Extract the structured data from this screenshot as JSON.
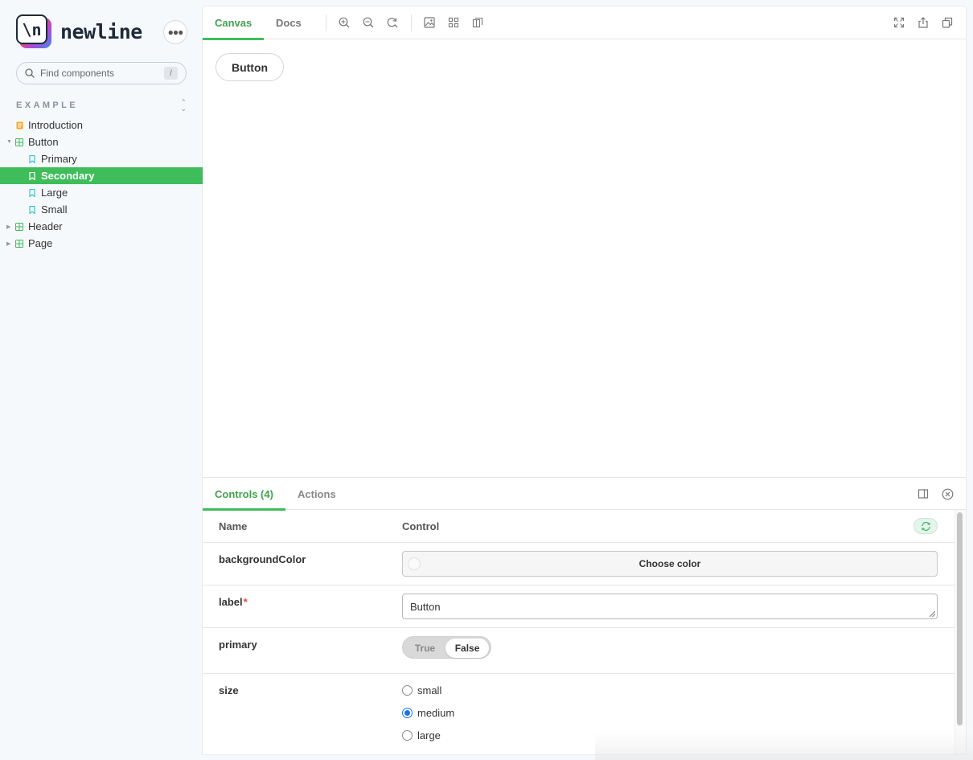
{
  "brand": {
    "logo_glyph": "\\n",
    "name": "newline"
  },
  "sidebar": {
    "search_placeholder": "Find components",
    "search_shortcut": "/",
    "section_title": "EXAMPLE",
    "items": [
      {
        "label": "Introduction",
        "icon": "document-icon",
        "kind": "doc"
      },
      {
        "label": "Button",
        "icon": "component-icon",
        "kind": "component",
        "expanded": true
      },
      {
        "label": "Primary",
        "icon": "bookmark-icon",
        "kind": "story"
      },
      {
        "label": "Secondary",
        "icon": "bookmark-icon",
        "kind": "story",
        "selected": true
      },
      {
        "label": "Large",
        "icon": "bookmark-icon",
        "kind": "story"
      },
      {
        "label": "Small",
        "icon": "bookmark-icon",
        "kind": "story"
      },
      {
        "label": "Header",
        "icon": "component-icon",
        "kind": "component",
        "expanded": false
      },
      {
        "label": "Page",
        "icon": "component-icon",
        "kind": "component",
        "expanded": false
      }
    ]
  },
  "toolbar": {
    "tabs": [
      {
        "label": "Canvas",
        "active": true
      },
      {
        "label": "Docs",
        "active": false
      }
    ],
    "tools": [
      "zoom-in-icon",
      "zoom-out-icon",
      "zoom-reset-icon",
      "background-icon",
      "grid-icon",
      "measure-icon"
    ],
    "right_tools": [
      "fullscreen-icon",
      "share-icon",
      "copy-link-icon"
    ]
  },
  "canvas": {
    "button_label": "Button"
  },
  "addons": {
    "tabs": [
      {
        "label": "Controls (4)",
        "active": true
      },
      {
        "label": "Actions",
        "active": false
      }
    ],
    "header": {
      "name": "Name",
      "control": "Control"
    },
    "rows": {
      "backgroundColor": {
        "name": "backgroundColor",
        "button_label": "Choose color"
      },
      "label": {
        "name": "label",
        "required_mark": "*",
        "value": "Button"
      },
      "primary": {
        "name": "primary",
        "true_label": "True",
        "false_label": "False",
        "value": false
      },
      "size": {
        "name": "size",
        "options": [
          "small",
          "medium",
          "large"
        ],
        "value": "medium"
      }
    }
  },
  "colors": {
    "accent": "#3fbd5a",
    "accent_text": "#3fa34d",
    "radio_checked": "#1a73e8"
  }
}
